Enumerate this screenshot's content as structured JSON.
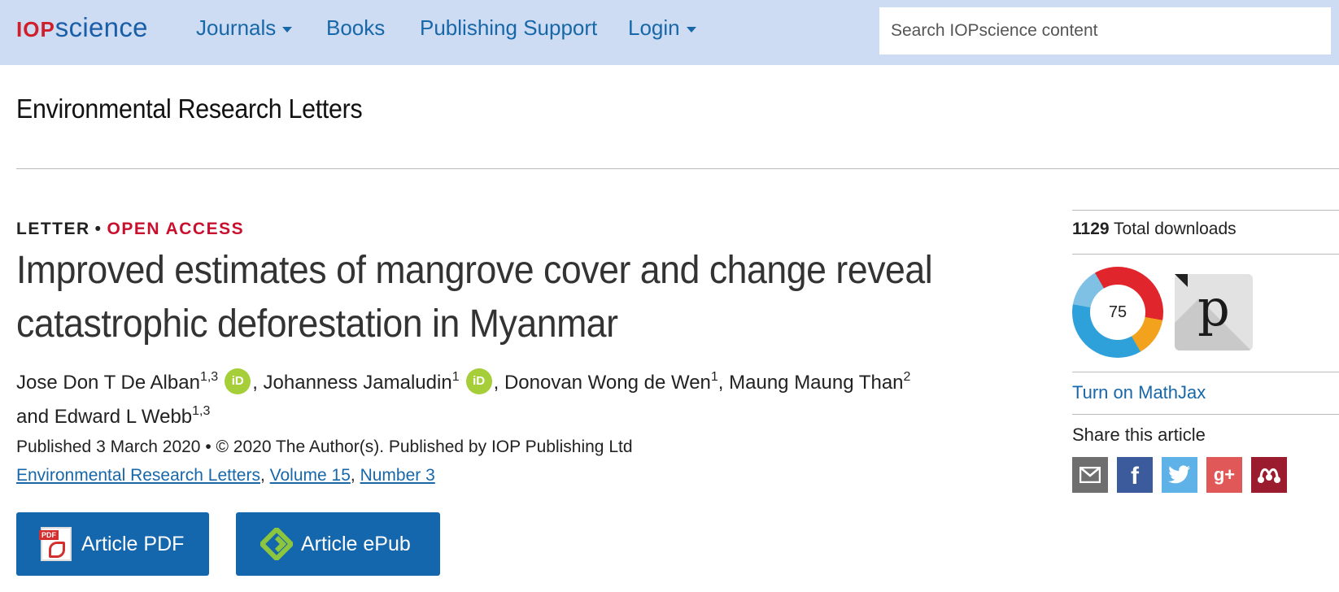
{
  "header": {
    "logo_prefix": "IOP",
    "logo_suffix": "science",
    "nav": [
      {
        "label": "Journals",
        "has_dropdown": true
      },
      {
        "label": "Books",
        "has_dropdown": false
      },
      {
        "label": "Publishing Support",
        "has_dropdown": false
      },
      {
        "label": "Login",
        "has_dropdown": true
      }
    ],
    "search_placeholder": "Search IOPscience content"
  },
  "journal_title": "Environmental Research Letters",
  "article": {
    "type": "LETTER",
    "bullet": "•",
    "access": "OPEN ACCESS",
    "title": "Improved estimates of mangrove cover and change reveal catastrophic deforestation in Myanmar",
    "authors": [
      {
        "name": "Jose Don T De Alban",
        "affil": "1,3",
        "orcid": true
      },
      {
        "name": "Johanness Jamaludin",
        "affil": "1",
        "orcid": true
      },
      {
        "name": "Donovan Wong de Wen",
        "affil": "1",
        "orcid": false
      },
      {
        "name": "Maung Maung Than",
        "affil": "2",
        "orcid": false
      },
      {
        "name": "Edward L Webb",
        "affil": "1,3",
        "orcid": false
      }
    ],
    "orcid_label": "iD",
    "comma": ", ",
    "and": " and ",
    "published": "Published 3 March 2020 • © 2020 The Author(s). Published by IOP Publishing Ltd",
    "citation": {
      "journal": "Environmental Research Letters",
      "volume": "Volume 15",
      "number": "Number 3",
      "separator": ", "
    },
    "buttons": {
      "pdf": "Article PDF",
      "pdf_tag": "PDF",
      "epub": "Article ePub"
    }
  },
  "sidebar": {
    "downloads_count": "1129",
    "downloads_label": " Total downloads",
    "altmetric_score": "75",
    "plumx_letter": "p",
    "mathjax": "Turn on MathJax",
    "share_title": "Share this article",
    "share_icons": [
      "mail-icon",
      "facebook-icon",
      "twitter-icon",
      "google-plus-icon",
      "mendeley-icon"
    ],
    "share_glyphs": {
      "facebook": "f",
      "google_plus": "g+"
    }
  },
  "colors": {
    "nav_bg": "#cddcf2",
    "link": "#1767a9",
    "open_access": "#c8102e",
    "button": "#1466ad",
    "orcid": "#a6ce39"
  }
}
